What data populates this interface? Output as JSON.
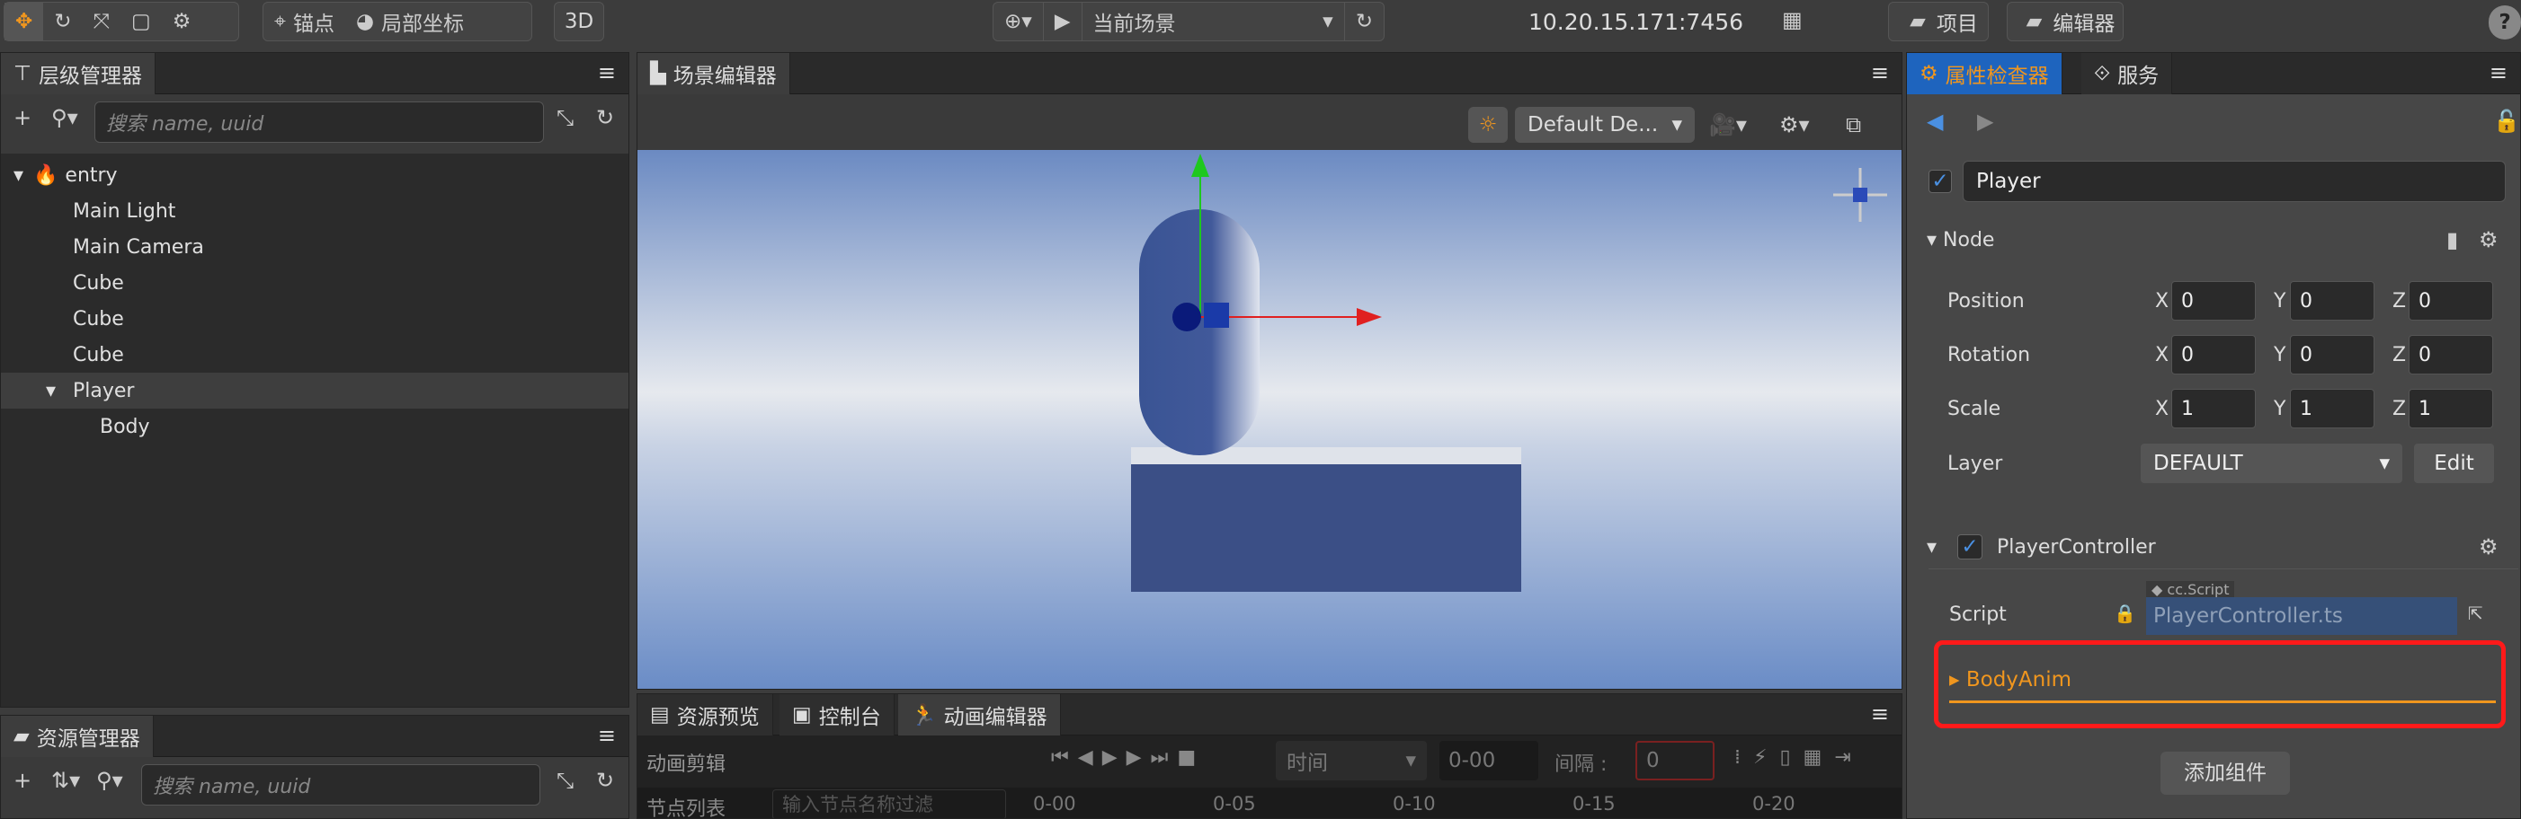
{
  "toolbar": {
    "anchor": "锚点",
    "local_coord": "局部坐标",
    "mode_3d": "3D",
    "scene_select": "当前场景",
    "ip": "10.20.15.171:7456",
    "project": "项目",
    "editor": "编辑器",
    "help": "?"
  },
  "hierarchy": {
    "title": "层级管理器",
    "search_placeholder": "搜索 name, uuid",
    "nodes": [
      {
        "label": "entry",
        "depth": 0
      },
      {
        "label": "Main Light",
        "depth": 1
      },
      {
        "label": "Main Camera",
        "depth": 1
      },
      {
        "label": "Cube",
        "depth": 1
      },
      {
        "label": "Cube",
        "depth": 1
      },
      {
        "label": "Cube",
        "depth": 1
      },
      {
        "label": "Player",
        "depth": 1,
        "selected": true
      },
      {
        "label": "Body",
        "depth": 2
      }
    ]
  },
  "assets": {
    "title": "资源管理器",
    "search_placeholder": "搜索 name, uuid"
  },
  "scene": {
    "title": "场景编辑器",
    "layout_select": "Default De..."
  },
  "bottom": {
    "tabs": [
      "资源预览",
      "控制台",
      "动画编辑器"
    ],
    "clip_label": "动画剪辑",
    "time_select": "时间",
    "time_value": "0-00",
    "interval_label": "间隔 :",
    "interval_value": "0",
    "node_list": "节点列表",
    "filter_placeholder": "输入节点名称过滤",
    "ticks": [
      "0-00",
      "0-05",
      "0-10",
      "0-15",
      "0-20"
    ]
  },
  "inspector": {
    "tab": "属性检查器",
    "tab2": "服务",
    "node_name": "Player",
    "node_section": "Node",
    "props": [
      {
        "label": "Position",
        "x": "0",
        "y": "0",
        "z": "0"
      },
      {
        "label": "Rotation",
        "x": "0",
        "y": "0",
        "z": "0"
      },
      {
        "label": "Scale",
        "x": "1",
        "y": "1",
        "z": "1"
      }
    ],
    "layer_label": "Layer",
    "layer_value": "DEFAULT",
    "edit": "Edit",
    "component": "PlayerController",
    "script_label": "Script",
    "script_type": "cc.Script",
    "script_value": "PlayerController.ts",
    "body_anim": "BodyAnim",
    "add_component": "添加组件"
  },
  "colors": {
    "accent": "#f0961e",
    "selected_tab": "#1e64be",
    "highlight_box": "#ff1a1a"
  }
}
